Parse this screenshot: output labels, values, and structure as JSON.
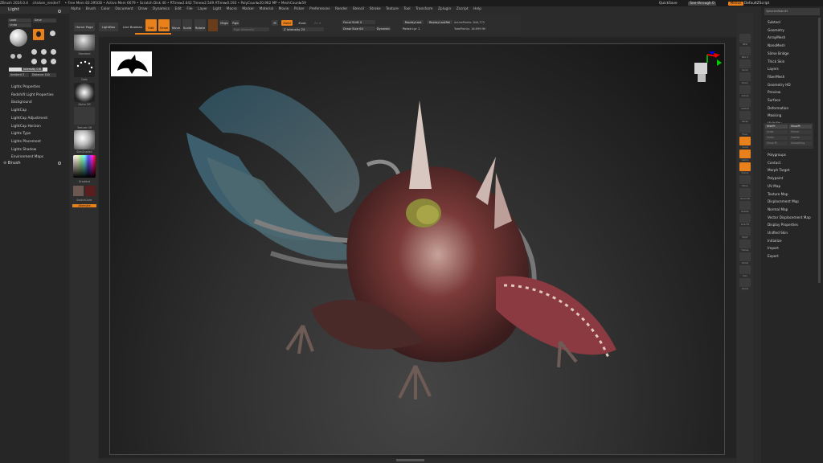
{
  "titlebar": {
    "app": "ZBrush 2024.0.4",
    "file": "chicken_render7",
    "stats": "• Free Mem 83.395GB • Active Mem 6679 • Scratch Disk 40 • RTime▸2.642 Timer▸2.549 ATime▸0.193 • PolyCount▸20.962 MP • MeshCount▸59",
    "quicksave": "QuickSave",
    "seethrough": "See-through 0",
    "menus": "Menus",
    "script": "DefaultZScript"
  },
  "menubar": [
    "Alpha",
    "Brush",
    "Color",
    "Document",
    "Draw",
    "Dynamics",
    "Edit",
    "File",
    "Layer",
    "Light",
    "Macro",
    "Marker",
    "Material",
    "Movie",
    "Picker",
    "Preferences",
    "Render",
    "Stencil",
    "Stroke",
    "Texture",
    "Tool",
    "Transform",
    "Zplugin",
    "Zscript",
    "Help"
  ],
  "coords": "-1.236,-0.636,-1.852",
  "left": {
    "title": "Light",
    "tab_load": "Load",
    "tab_save": "Save",
    "tab_undo": "Undo",
    "intensity": "Intensity 0.6",
    "ambient": "Ambient 3",
    "distance": "Distance 100",
    "sub": [
      "Lights Properties",
      "Redshift Light Properties",
      "Background",
      "LightCap",
      "LightCap Adjustment",
      "LightCap Horizon",
      "Lights Type",
      "Lights Placement",
      "Lights Shadow",
      "Environment Maps"
    ],
    "brush": "Brush"
  },
  "shelf": {
    "standard": "Standard",
    "dots": "Dots",
    "alpha": "Alpha Off",
    "texture": "Texture Off",
    "material": "SkinShade4",
    "gradient": "Gradient",
    "switch": "SwitchColor",
    "alternate": "Alternate"
  },
  "toolbar": {
    "home": "Home Page",
    "lightbox": "LightBox",
    "livebool": "Live Boolean",
    "edit": "Edit",
    "draw": "Draw",
    "move": "Move",
    "scale": "Scale",
    "rotate": "Rotate",
    "mrgb": "Mrgb",
    "rgb": "Rgb",
    "m": "M",
    "zadd": "Zadd",
    "zsub": "Zsub",
    "zcut": "Zcut",
    "rgb_intensity": "Rgb Intensity",
    "z_intensity": "Z Intensity 25",
    "focal_shift": "Focal Shift 0",
    "draw_size": "Draw Size 64",
    "dynamic": "Dynamic",
    "replay_last": "ReplayLast",
    "replay_rel": "ReplayLastRel",
    "active_points": "ActivePoints: 844,772",
    "total_points": "TotalPoints: 16.699 Mil",
    "active_lyr": "ActiveLyr 0",
    "polish": "Polish Lyr 1"
  },
  "rightshelf": [
    "BPR",
    "SPix 3",
    "Scroll",
    "Zoom",
    "Actual",
    "AAHalf",
    "Persp",
    "Floor",
    "Local",
    "Gizmo",
    "Frame",
    "Move",
    "Zoom3D",
    "Rotate",
    "Line Fill",
    "PolyF",
    "Transp",
    "Ghost",
    "Solo",
    "Xpose"
  ],
  "right": {
    "header": "SphereInflate 65",
    "top": [
      "Subtool",
      "Geometry",
      "ArrayMesh",
      "NanoMesh",
      "Slime Bridge",
      "Thick Skin",
      "Layers",
      "FiberMesh",
      "Geometry HD",
      "Preview",
      "Surface",
      "Deformation",
      "Masking",
      "Visibility"
    ],
    "vis_buttons": [
      "HidePt",
      "ShowPt",
      "Grow",
      "Shrink",
      "Outer",
      "Coarse",
      "Show Pt",
      "Smoothing"
    ],
    "bottom": [
      "Polygroups",
      "Contact",
      "Morph Target",
      "Polypaint",
      "UV Map",
      "Texture Map",
      "Displacement Map",
      "Normal Map",
      "Vector Displacement Map",
      "Display Properties",
      "Unified Skin",
      "Initialize",
      "Import",
      "Export"
    ]
  },
  "colors": {
    "accent": "#e8801c",
    "bg": "#2b2b2b"
  }
}
